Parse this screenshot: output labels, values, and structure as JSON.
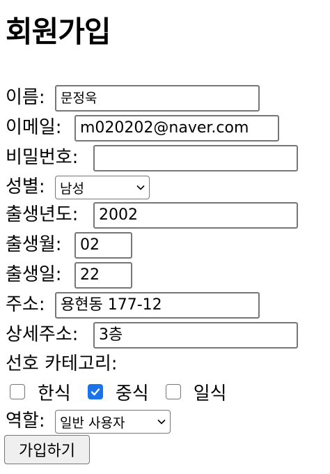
{
  "page_title": "회원가입",
  "form": {
    "name": {
      "label": "이름:",
      "value": "문정욱"
    },
    "email": {
      "label": "이메일:",
      "value": "m020202@naver.com"
    },
    "password": {
      "label": "비밀번호:",
      "value": ""
    },
    "gender": {
      "label": "성별:",
      "selected": "남성"
    },
    "birth_year": {
      "label": "출생년도:",
      "value": "2002"
    },
    "birth_month": {
      "label": "출생월:",
      "value": "02"
    },
    "birth_day": {
      "label": "출생일:",
      "value": "22"
    },
    "address": {
      "label": "주소:",
      "value": "용현동 177-12"
    },
    "address_detail": {
      "label": "상세주소:",
      "value": "3층"
    },
    "categories": {
      "label": "선호 카테고리:",
      "options": [
        {
          "label": "한식",
          "checked": false
        },
        {
          "label": "중식",
          "checked": true
        },
        {
          "label": "일식",
          "checked": false
        }
      ]
    },
    "role": {
      "label": "역할:",
      "selected": "일반 사용자"
    },
    "submit_label": "가입하기"
  },
  "colors": {
    "checkbox_checked": "#1a73e8",
    "input_border": "#767676",
    "button_bg": "#efefef"
  }
}
